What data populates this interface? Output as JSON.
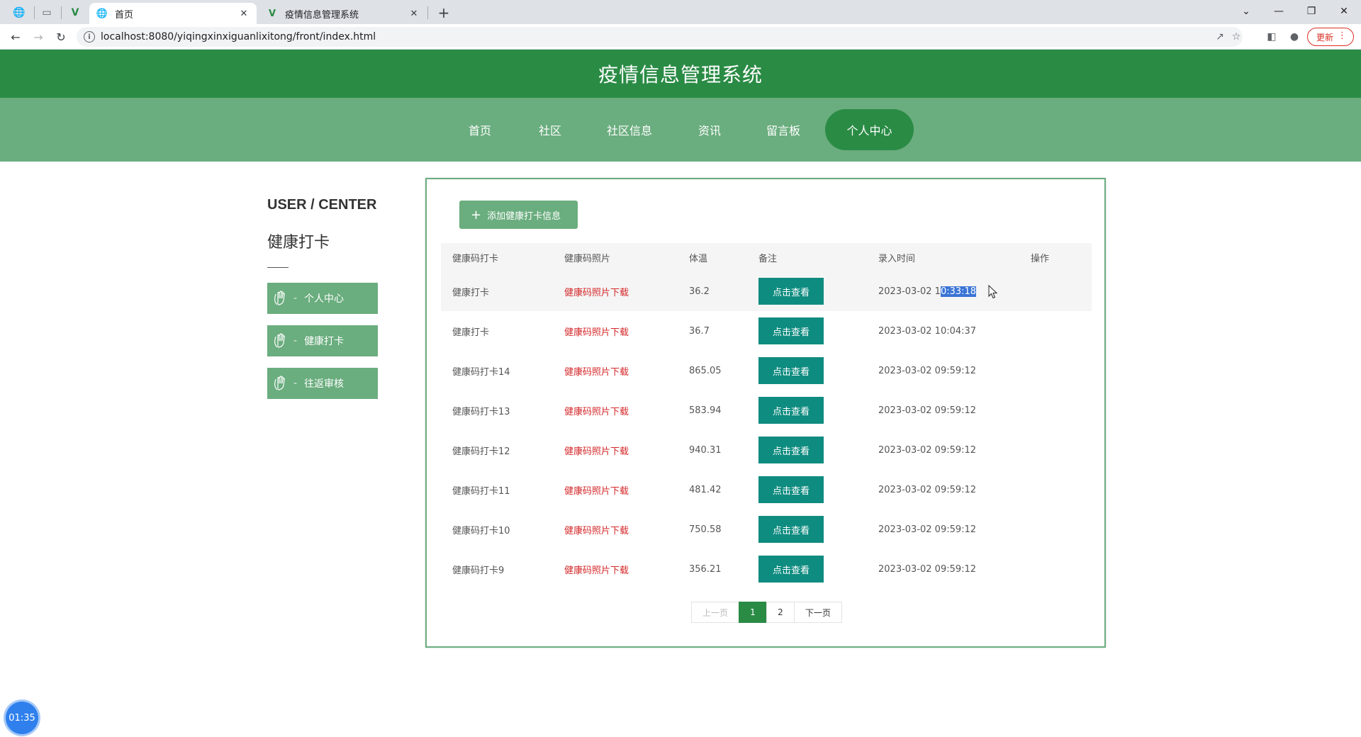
{
  "browser": {
    "tabs": [
      {
        "title": "首页",
        "active": true
      },
      {
        "title": "疫情信息管理系统",
        "active": false
      }
    ],
    "url": "localhost:8080/yiqingxinxiguanlixitong/front/index.html",
    "update_label": "更新"
  },
  "site": {
    "title": "疫情信息管理系统",
    "nav": [
      "首页",
      "社区",
      "社区信息",
      "资讯",
      "留言板",
      "个人中心"
    ],
    "active_nav": "个人中心"
  },
  "sidebar": {
    "title": "USER / CENTER",
    "subtitle": "健康打卡",
    "items": [
      {
        "label": "个人中心"
      },
      {
        "label": "健康打卡"
      },
      {
        "label": "往返审核"
      }
    ]
  },
  "main": {
    "add_button": "添加健康打卡信息",
    "columns": [
      "健康码打卡",
      "健康码照片",
      "体温",
      "备注",
      "录入时间",
      "操作"
    ],
    "view_label": "点击查看",
    "rows": [
      {
        "name": "健康打卡",
        "photo": "健康码照片下载",
        "temp": "36.2",
        "date": "2023-03-02 1",
        "time_sel": "0:33:18"
      },
      {
        "name": "健康打卡",
        "photo": "健康码照片下载",
        "temp": "36.7",
        "date": "2023-03-02 10:04:37",
        "time_sel": ""
      },
      {
        "name": "健康码打卡14",
        "photo": "健康码照片下载",
        "temp": "865.05",
        "date": "2023-03-02 09:59:12",
        "time_sel": ""
      },
      {
        "name": "健康码打卡13",
        "photo": "健康码照片下载",
        "temp": "583.94",
        "date": "2023-03-02 09:59:12",
        "time_sel": ""
      },
      {
        "name": "健康码打卡12",
        "photo": "健康码照片下载",
        "temp": "940.31",
        "date": "2023-03-02 09:59:12",
        "time_sel": ""
      },
      {
        "name": "健康码打卡11",
        "photo": "健康码照片下载",
        "temp": "481.42",
        "date": "2023-03-02 09:59:12",
        "time_sel": ""
      },
      {
        "name": "健康码打卡10",
        "photo": "健康码照片下载",
        "temp": "750.58",
        "date": "2023-03-02 09:59:12",
        "time_sel": ""
      },
      {
        "name": "健康码打卡9",
        "photo": "健康码照片下载",
        "temp": "356.21",
        "date": "2023-03-02 09:59:12",
        "time_sel": ""
      }
    ],
    "pager": {
      "prev": "上一页",
      "pages": [
        "1",
        "2"
      ],
      "current": "1",
      "next": "下一页"
    }
  },
  "timer": "01:35",
  "colors": {
    "header": "#2a8b45",
    "nav": "#6aad7e",
    "view_button": "#0f8c80",
    "link": "#d5282a"
  }
}
